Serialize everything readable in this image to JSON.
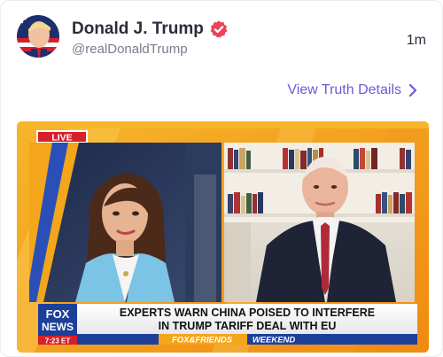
{
  "post": {
    "display_name": "Donald J. Trump",
    "handle": "@realDonaldTrump",
    "timestamp": "1m",
    "details_link": "View Truth Details"
  },
  "video": {
    "live_badge": "LIVE",
    "headline_line1": "EXPERTS WARN CHINA POISED TO INTERFERE",
    "headline_line2": "IN TRUMP TARIFF DEAL WITH EU",
    "network_line1": "FOX",
    "network_line2": "NEWS",
    "clock": "7:23 ET",
    "show_name": "FOX&FRIENDS",
    "show_suffix": "WEEKEND"
  },
  "colors": {
    "accent": "#6a5ad8",
    "verified": "#e8445a",
    "live_red": "#d5202a",
    "ticker_blue": "#1c3f9a"
  }
}
